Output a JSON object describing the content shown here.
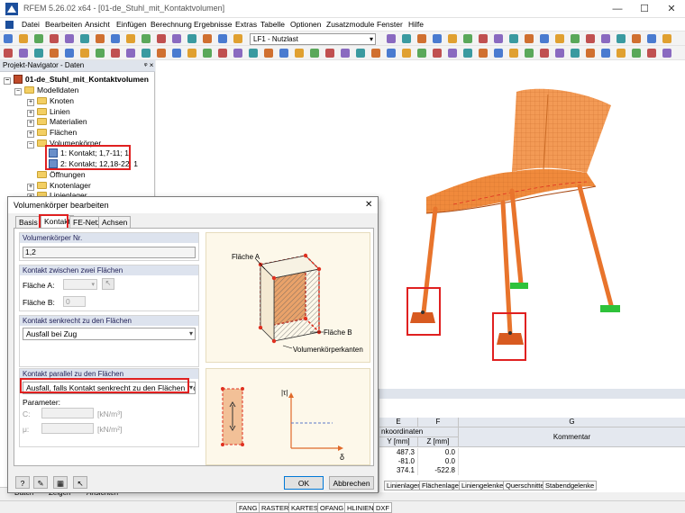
{
  "window": {
    "title": "RFEM 5.26.02 x64 - [01-de_Stuhl_mit_Kontaktvolumen]"
  },
  "menu": [
    "Datei",
    "Bearbeiten",
    "Ansicht",
    "Einfügen",
    "Berechnung",
    "Ergebnisse",
    "Extras",
    "Tabelle",
    "Optionen",
    "Zusatzmodule",
    "Fenster",
    "Hilfe"
  ],
  "toolbar": {
    "loadcase": "LF1 - Nutzlast"
  },
  "navigator": {
    "header": "Projekt-Navigator - Daten",
    "root": "01-de_Stuhl_mit_Kontaktvolumen",
    "modeldata": "Modelldaten",
    "items": [
      "Knoten",
      "Linien",
      "Materialien",
      "Flächen"
    ],
    "solids_folder": "Volumenkörper",
    "solids": [
      "1: Kontakt; 1,7-11; 1",
      "2: Kontakt; 12,18-22; 1"
    ],
    "items_after": [
      "Öffnungen",
      "Knotenlager",
      "Linienlager"
    ],
    "bottom_tabs": [
      "Daten",
      "Zeigen",
      "Ansichten"
    ]
  },
  "dialog": {
    "title": "Volumenkörper bearbeiten",
    "tabs": [
      "Basis",
      "Kontakt",
      "FE-Netz",
      "Achsen"
    ],
    "solid_no_label": "Volumenkörper Nr.",
    "solid_no_value": "1,2",
    "contact_two_surfaces": "Kontakt zwischen zwei Flächen",
    "surface_a": "Fläche A:",
    "surface_b": "Fläche B:",
    "surface_b_value": "0",
    "perpendicular_header": "Kontakt senkrecht zu den Flächen",
    "perpendicular_value": "Ausfall bei Zug",
    "parallel_header": "Kontakt parallel zu den Flächen",
    "parallel_value": "Ausfall, falls Kontakt senkrecht zu den Flächen nicht wirkt",
    "parameter": "Parameter:",
    "c_label": "C:",
    "c_unit": "[kN/m³]",
    "mu_label": "μ:",
    "mu_unit": "[kN/m²]",
    "fig_surface_a": "Fläche A",
    "fig_surface_b": "Fläche B",
    "fig_edges": "Volumenkörperkanten",
    "fig_tau": "|τ|",
    "fig_delta": "δ",
    "ok": "OK",
    "cancel": "Abbrechen"
  },
  "table": {
    "col_e": "E",
    "col_f": "F",
    "col_g": "G",
    "sub_header": "nkoordinaten",
    "y_head": "Y [mm]",
    "z_head": "Z [mm]",
    "comment_head": "Kommentar",
    "rows": [
      [
        "487.3",
        "0.0"
      ],
      [
        "-81.0",
        "0.0"
      ],
      [
        "374.1",
        "-522.8"
      ]
    ],
    "tabs": [
      "Linienlager",
      "Flächenlager",
      "Liniengelenke",
      "Querschnitte",
      "Stabendgelenke"
    ]
  },
  "statusbar": [
    "FANG",
    "RASTER",
    "KARTES",
    "OFANG",
    "HLINIEN",
    "DXF"
  ],
  "colors": {
    "accent_red": "#e02020",
    "chair": "#f08a3c",
    "support_green": "#2ec23a"
  }
}
